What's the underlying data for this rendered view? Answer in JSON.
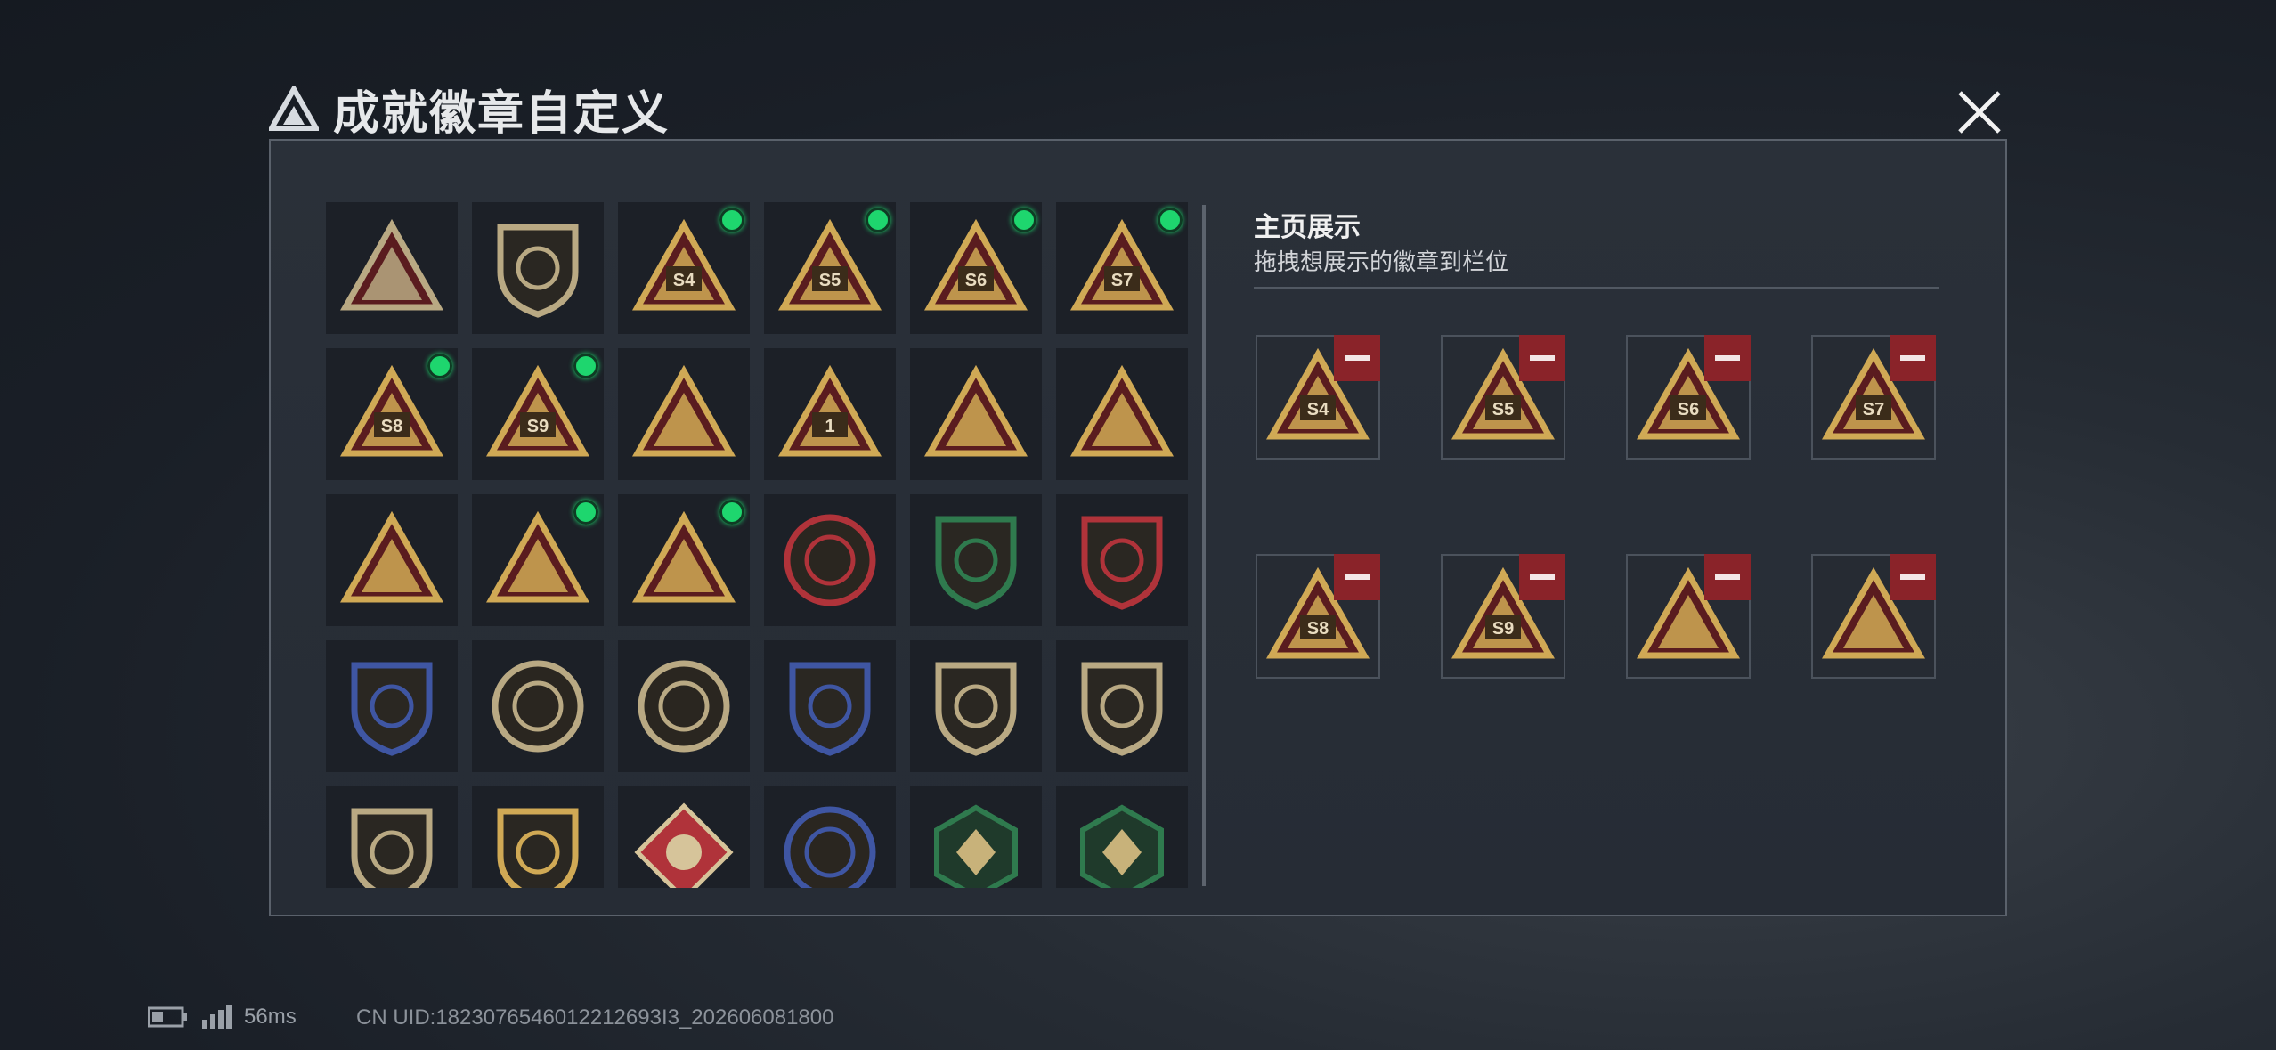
{
  "dialog": {
    "title": "成就徽章自定义",
    "close_icon": "close-icon"
  },
  "badge_grid": [
    {
      "icon": "shield-triangle-badge",
      "color": "#b9a983",
      "dot": false
    },
    {
      "icon": "helicopter-shield-badge",
      "color": "#b9a983",
      "dot": false
    },
    {
      "icon": "season-badge",
      "label": "S4",
      "color": "#d0a955",
      "dot": true
    },
    {
      "icon": "season-badge",
      "label": "S5",
      "color": "#d0a955",
      "dot": true
    },
    {
      "icon": "season-badge",
      "label": "S6",
      "color": "#d0a955",
      "dot": true
    },
    {
      "icon": "season-badge",
      "label": "S7",
      "color": "#d0a955",
      "dot": true
    },
    {
      "icon": "season-badge",
      "label": "S8",
      "color": "#d0a955",
      "dot": true
    },
    {
      "icon": "season-badge",
      "label": "S9",
      "color": "#d0a955",
      "dot": true
    },
    {
      "icon": "ship-triangle-badge",
      "color": "#d0a955",
      "dot": false
    },
    {
      "icon": "number-one-triangle-badge",
      "label": "1",
      "color": "#d0a955",
      "dot": false
    },
    {
      "icon": "usb-triangle-badge",
      "color": "#d0a955",
      "dot": false
    },
    {
      "icon": "wave-triangle-badge",
      "color": "#d0a955",
      "dot": false
    },
    {
      "icon": "squad-triangle-badge",
      "color": "#d0a955",
      "dot": false
    },
    {
      "icon": "soldiers-triangle-badge",
      "color": "#d0a955",
      "dot": true
    },
    {
      "icon": "rocket-triangle-badge",
      "color": "#d0a955",
      "dot": true
    },
    {
      "icon": "star-round-badge",
      "color": "#b0333a",
      "dot": false
    },
    {
      "icon": "green-shield-badge",
      "color": "#2f7a4e",
      "dot": false
    },
    {
      "icon": "red-star-shield-badge",
      "color": "#b0333a",
      "dot": false
    },
    {
      "icon": "blue-shield-badge",
      "color": "#3f56a3",
      "dot": false
    },
    {
      "icon": "crosshair-round-badge",
      "color": "#b9a983",
      "dot": false
    },
    {
      "icon": "skull-round-badge",
      "color": "#b9a983",
      "dot": false
    },
    {
      "icon": "blue-crosshair-shield-badge",
      "color": "#3f56a3",
      "dot": false
    },
    {
      "icon": "rifle-shield-badge",
      "color": "#b9a983",
      "dot": false
    },
    {
      "icon": "rifle-shield-badge",
      "color": "#b9a983",
      "dot": false
    },
    {
      "icon": "sniper-shield-badge",
      "color": "#b9a983",
      "dot": false
    },
    {
      "icon": "gold-crosshair-shield-badge",
      "color": "#d0a955",
      "dot": false
    },
    {
      "icon": "wolf-diamond-badge",
      "color": "#b0333a",
      "dot": false
    },
    {
      "icon": "eagle-round-badge",
      "color": "#3f56a3",
      "dot": false
    },
    {
      "icon": "wasp-hex-badge",
      "color": "#2f7a4e",
      "dot": false
    },
    {
      "icon": "medic-hex-badge",
      "color": "#2f7a4e",
      "dot": false
    }
  ],
  "showcase": {
    "title": "主页展示",
    "subtitle": "拖拽想展示的徽章到栏位",
    "slots": [
      {
        "icon": "season-badge",
        "label": "S4",
        "remove_icon": "minus-icon"
      },
      {
        "icon": "season-badge",
        "label": "S5",
        "remove_icon": "minus-icon"
      },
      {
        "icon": "season-badge",
        "label": "S6",
        "remove_icon": "minus-icon"
      },
      {
        "icon": "season-badge",
        "label": "S7",
        "remove_icon": "minus-icon"
      },
      {
        "icon": "season-badge",
        "label": "S8",
        "remove_icon": "minus-icon"
      },
      {
        "icon": "season-badge",
        "label": "S9",
        "remove_icon": "minus-icon"
      },
      {
        "icon": "rocket-triangle-badge",
        "remove_icon": "minus-icon"
      },
      {
        "icon": "squad-triangle-badge",
        "remove_icon": "minus-icon"
      }
    ]
  },
  "status": {
    "battery_icon": "battery-icon",
    "signal_icon": "signal-icon",
    "ping": "56ms",
    "uid": "CN UID:1823076546012212693I3_202606081800"
  },
  "colors": {
    "accent_green": "#1ed66e",
    "remove_red": "#8a2329",
    "gold": "#d0a955"
  }
}
